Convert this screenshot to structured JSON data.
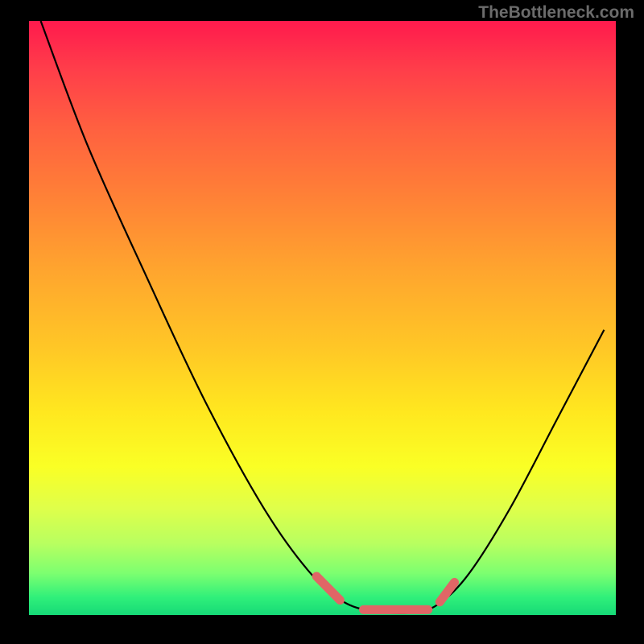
{
  "watermark": "TheBottleneck.com",
  "chart_data": {
    "type": "line",
    "title": "",
    "xlabel": "",
    "ylabel": "",
    "xlim": [
      0,
      100
    ],
    "ylim": [
      0,
      100
    ],
    "gradient_colors": {
      "top": "#ff1a4d",
      "mid_high": "#ffa52e",
      "mid": "#ffe81f",
      "low": "#7cff70",
      "bottom": "#16d977"
    },
    "curve": {
      "comment": "x in 0..100 plot units, y is percentage bottleneck (0 = bottom/green, 100 = top/red)",
      "points": [
        {
          "x": 2,
          "y": 100
        },
        {
          "x": 10,
          "y": 79
        },
        {
          "x": 20,
          "y": 57
        },
        {
          "x": 30,
          "y": 36
        },
        {
          "x": 40,
          "y": 18
        },
        {
          "x": 48,
          "y": 7
        },
        {
          "x": 54,
          "y": 2
        },
        {
          "x": 60,
          "y": 0.5
        },
        {
          "x": 66,
          "y": 0.5
        },
        {
          "x": 70,
          "y": 2
        },
        {
          "x": 75,
          "y": 7
        },
        {
          "x": 82,
          "y": 18
        },
        {
          "x": 90,
          "y": 33
        },
        {
          "x": 98,
          "y": 48
        }
      ]
    },
    "markers": {
      "color": "#e06666",
      "comment": "short thick salmon segments near the minimum",
      "segments": [
        [
          {
            "x": 49,
            "y": 6.5
          },
          {
            "x": 53,
            "y": 2.5
          }
        ],
        [
          {
            "x": 57,
            "y": 0.9
          },
          {
            "x": 68,
            "y": 0.9
          }
        ],
        [
          {
            "x": 70,
            "y": 2.2
          },
          {
            "x": 72.5,
            "y": 5.5
          }
        ]
      ]
    }
  }
}
